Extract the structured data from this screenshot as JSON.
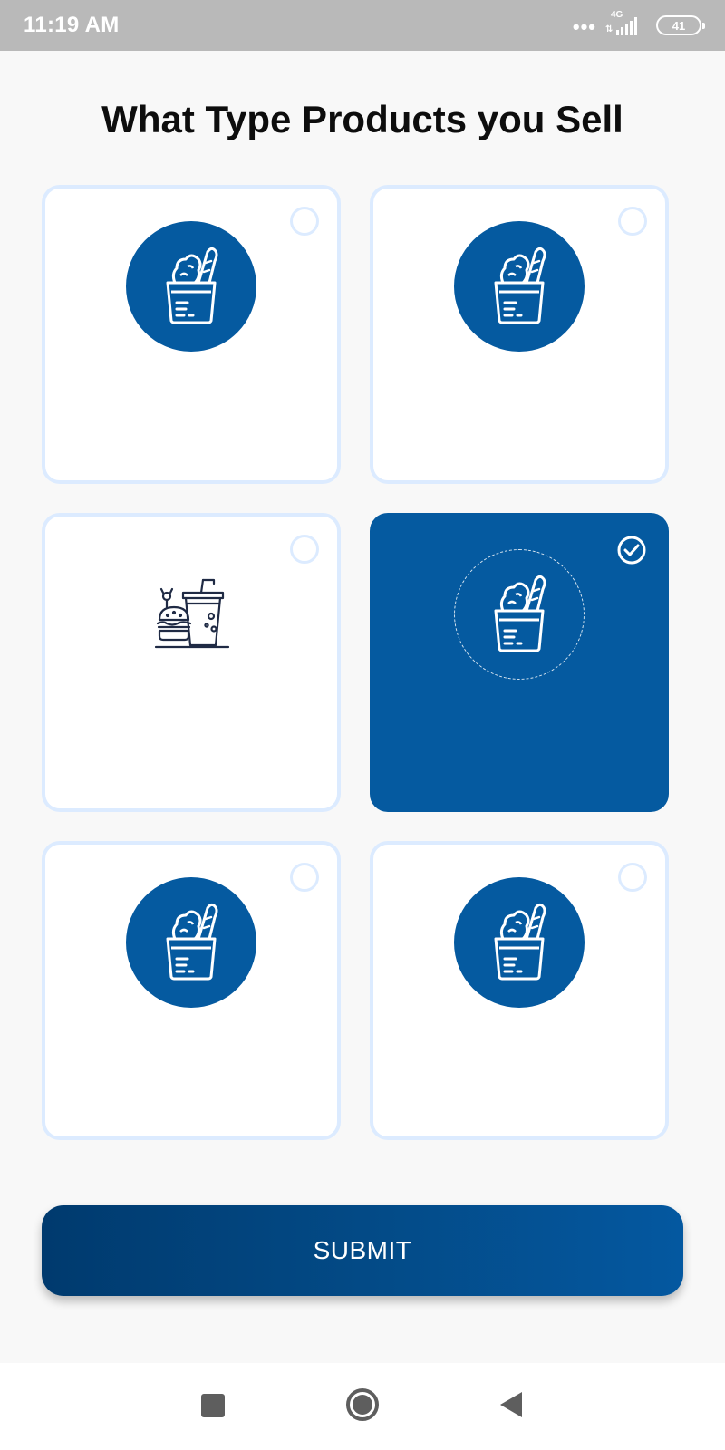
{
  "status_bar": {
    "time": "11:19 AM",
    "network_type": "4G",
    "battery_level": "41",
    "signal_icon": "cell-signal-icon"
  },
  "page": {
    "title": "What Type Products you Sell"
  },
  "categories": [
    {
      "icon": "grocery-bag-icon",
      "selected": false
    },
    {
      "icon": "grocery-bag-icon",
      "selected": false
    },
    {
      "icon": "fast-food-icon",
      "selected": false
    },
    {
      "icon": "grocery-bag-icon",
      "selected": true
    },
    {
      "icon": "grocery-bag-icon",
      "selected": false
    },
    {
      "icon": "grocery-bag-icon",
      "selected": false
    }
  ],
  "actions": {
    "submit_label": "SUBMIT"
  },
  "colors": {
    "primary": "#055aa0",
    "card_border": "#dcebff",
    "gradient_start": "#003a6e",
    "gradient_end": "#0458a0"
  },
  "nav_bar": {
    "recents_icon": "square-recents-icon",
    "home_icon": "circle-home-icon",
    "back_icon": "triangle-back-icon"
  }
}
